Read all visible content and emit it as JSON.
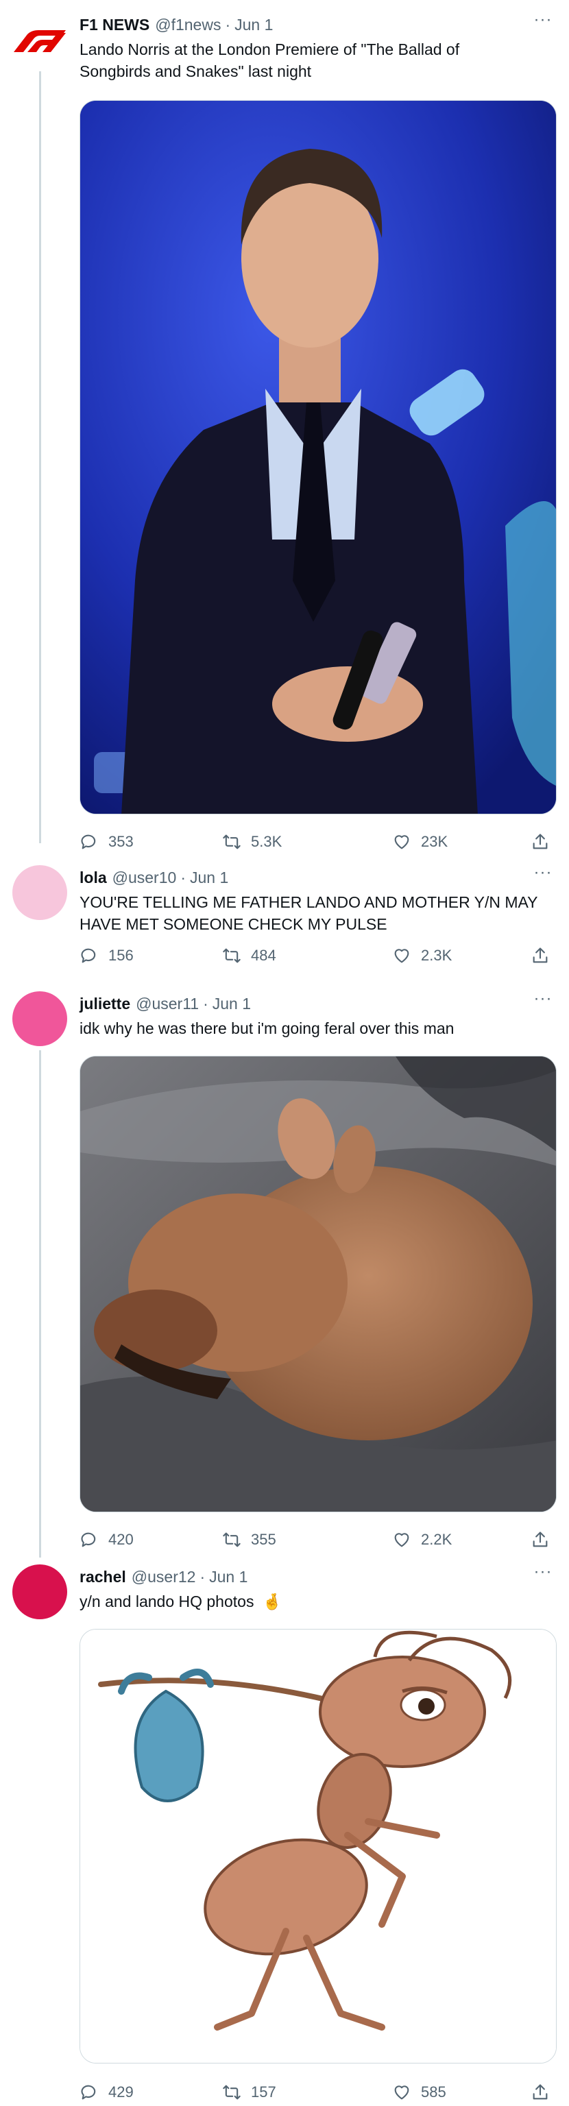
{
  "tweets": [
    {
      "name": "F1 NEWS",
      "handle": "@f1news",
      "date": "Jun 1",
      "more": "···",
      "text": "Lando Norris at the London Premiere of \"The Ballad of Songbirds and Snakes\" last night",
      "media": "photo of a man in a dark suit on stage holding a microphone, blue stage lights",
      "replies": "353",
      "retweets": "5.3K",
      "likes": "23K"
    },
    {
      "name": "lola",
      "handle": "@user10",
      "date": "Jun 1",
      "more": "···",
      "text": "YOU'RE TELLING ME FATHER LANDO AND MOTHER Y/N MAY HAVE MET SOMEONE CHECK MY PULSE",
      "replies": "156",
      "retweets": "484",
      "likes": "2.3K",
      "avatar_color": "#f7c6dc"
    },
    {
      "name": "juliette",
      "handle": "@user11",
      "date": "Jun 1",
      "more": "···",
      "text": "idk why he was there but i'm going feral over this man",
      "media": "blurry photo of a small brown animal lying on a grey blanket",
      "replies": "420",
      "retweets": "355",
      "likes": "2.2K",
      "avatar_color": "#f0569a"
    },
    {
      "name": "rachel",
      "handle": "@user12",
      "date": "Jun 1",
      "more": "···",
      "text": "y/n and lando HQ photos",
      "emoji": "🤞",
      "media": "cartoon ant carrying a blue bindle on a stick",
      "replies": "429",
      "retweets": "157",
      "likes": "585",
      "avatar_color": "#d8114d"
    }
  ],
  "colors": {
    "text_primary": "#0f1419",
    "text_secondary": "#536471",
    "thread_line": "#cfd9de",
    "f1_red": "#e10600"
  }
}
